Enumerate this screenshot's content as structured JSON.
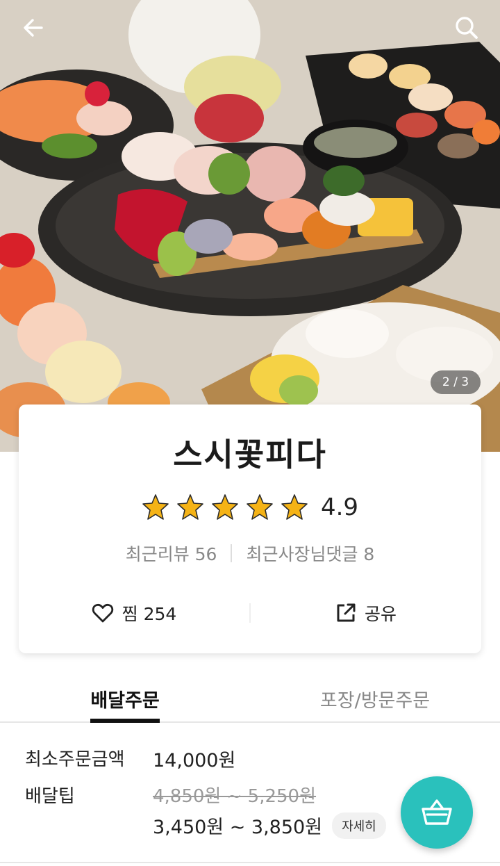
{
  "header": {
    "back_icon": "arrow-left-icon",
    "search_icon": "search-icon",
    "image_pager": "2 / 3"
  },
  "store": {
    "name": "스시꽃피다",
    "rating_stars": 5,
    "rating": "4.9",
    "recent_reviews": "최근리뷰 56",
    "owner_replies": "최근사장님댓글 8",
    "like_label": "찜 254",
    "share_label": "공유"
  },
  "tabs": [
    {
      "label": "배달주문",
      "active": true
    },
    {
      "label": "포장/방문주문",
      "active": false
    }
  ],
  "info": {
    "min_order_label": "최소주문금액",
    "min_order_value": "14,000원",
    "delivery_tip_label": "배달팁",
    "delivery_tip_old": "4,850원 ~ 5,250원",
    "delivery_tip_new": "3,450원 ~ 3,850원",
    "detail_button": "자세히"
  },
  "colors": {
    "accent": "#2ac1bc",
    "star": "#f5b316",
    "text": "#222222",
    "muted": "#888888"
  }
}
